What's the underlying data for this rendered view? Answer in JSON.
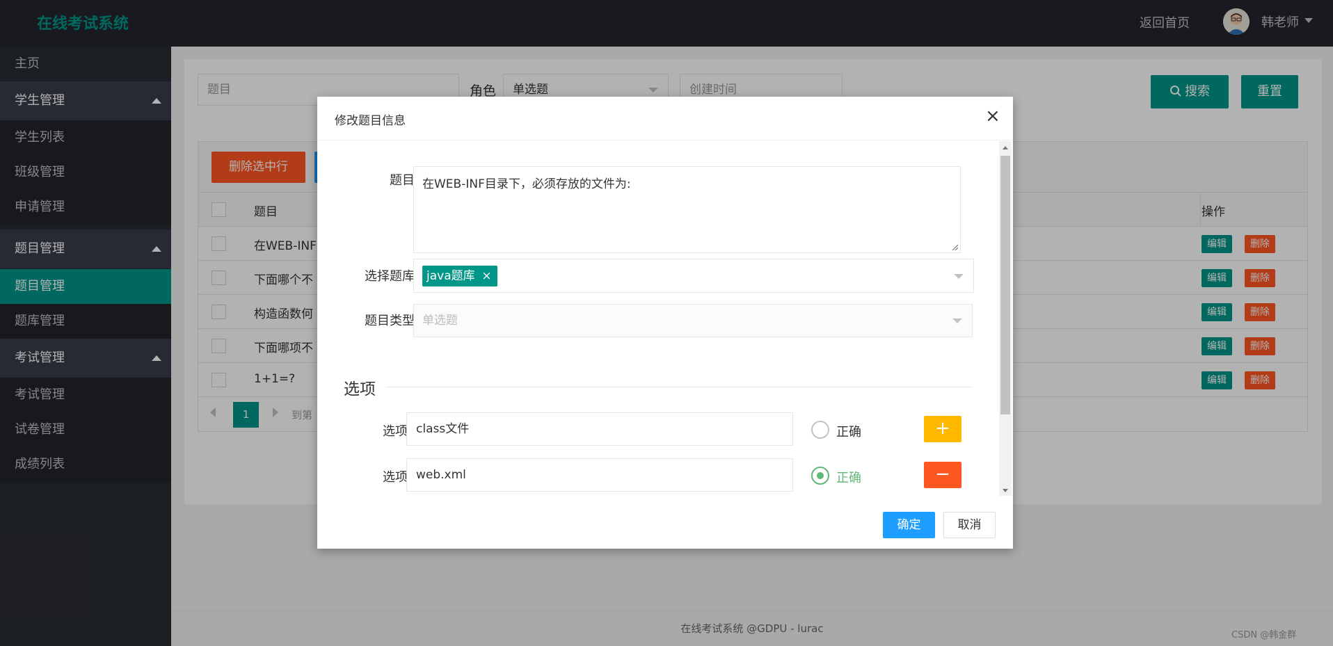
{
  "header": {
    "logo": "在线考试系统",
    "home_link": "返回首页",
    "username": "韩老师"
  },
  "sidebar": {
    "home": "主页",
    "groups": [
      {
        "label": "学生管理",
        "items": [
          "学生列表",
          "班级管理",
          "申请管理"
        ]
      },
      {
        "label": "题目管理",
        "items": [
          "题目管理",
          "题库管理"
        ]
      },
      {
        "label": "考试管理",
        "items": [
          "考试管理",
          "试卷管理",
          "成绩列表"
        ]
      }
    ]
  },
  "search": {
    "title_placeholder": "题目",
    "role_label": "角色",
    "role_value": "单选题",
    "created_placeholder": "创建时间",
    "search_button": "搜索",
    "reset_button": "重置"
  },
  "table": {
    "delete_selected": "删除选中行",
    "col_title": "题目",
    "col_ops": "操作",
    "rows": [
      "在WEB-INF",
      "下面哪个不",
      "构造函数何",
      "下面哪项不",
      "1+1=?"
    ],
    "edit_label": "编辑",
    "delete_label": "删除",
    "pager_page": "1",
    "pager_goto": "到第"
  },
  "footer": "在线考试系统 @GDPU - lurac",
  "watermark": "CSDN @韩金群",
  "modal": {
    "title": "修改题目信息",
    "close": "×",
    "field_title_label": "题目",
    "field_title_value": "在WEB-INF目录下，必须存放的文件为:",
    "field_bank_label": "选择题库",
    "field_bank_tag": "java题库",
    "field_bank_tag_remove": "×",
    "field_type_label": "题目类型",
    "field_type_placeholder": "单选题",
    "options_section": "选项",
    "options": [
      {
        "label": "选项",
        "value": "class文件",
        "correct_label": "正确",
        "checked": false,
        "button": "+"
      },
      {
        "label": "选项",
        "value": "web.xml",
        "correct_label": "正确",
        "checked": true,
        "button": "−"
      }
    ],
    "confirm_button": "确定",
    "cancel_button": "取消"
  },
  "colors": {
    "brand": "#009688",
    "danger": "#ff5722",
    "primary": "#1e9fff",
    "warm": "#ffb800",
    "radio_checked": "#5fb878"
  }
}
